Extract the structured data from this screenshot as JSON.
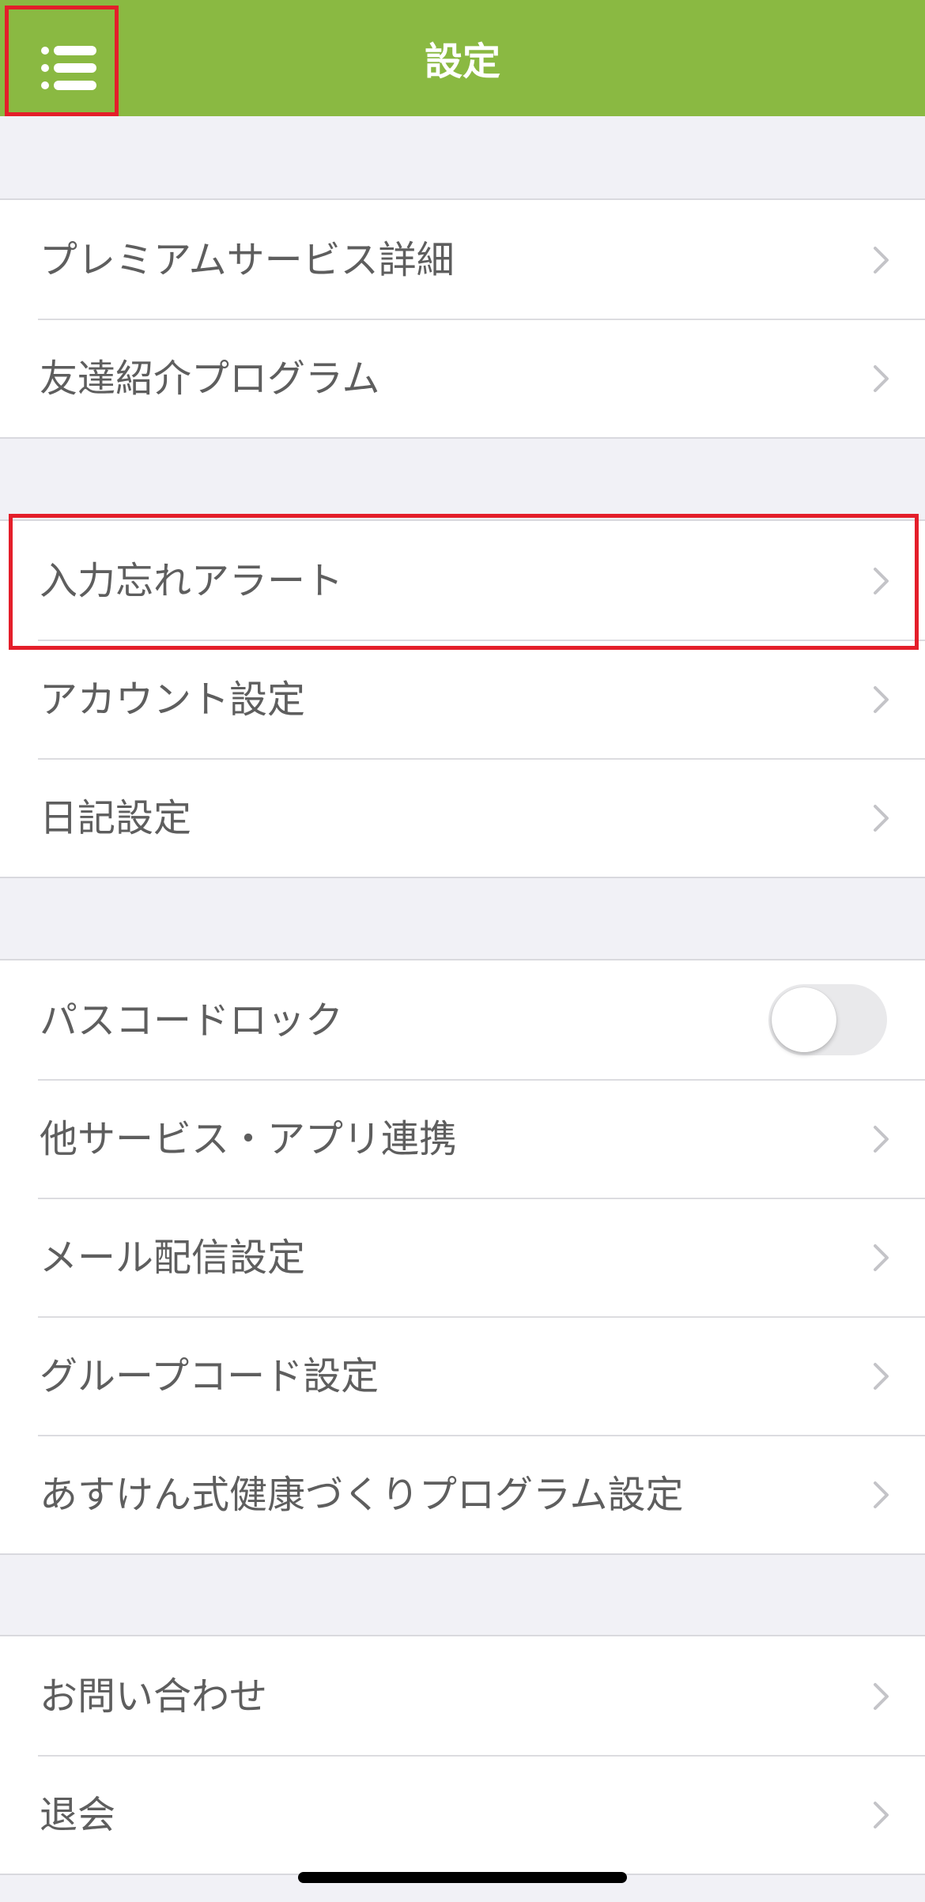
{
  "header": {
    "title": "設定",
    "menu_icon": "list-menu-icon",
    "background": "#8ab942"
  },
  "groups": [
    {
      "items": [
        {
          "label": "プレミアムサービス詳細",
          "control": "chevron"
        },
        {
          "label": "友達紹介プログラム",
          "control": "chevron"
        }
      ]
    },
    {
      "items": [
        {
          "label": "入力忘れアラート",
          "control": "chevron",
          "highlighted": true
        },
        {
          "label": "アカウント設定",
          "control": "chevron"
        },
        {
          "label": "日記設定",
          "control": "chevron"
        }
      ]
    },
    {
      "items": [
        {
          "label": "パスコードロック",
          "control": "toggle",
          "toggle_on": false
        },
        {
          "label": "他サービス・アプリ連携",
          "control": "chevron"
        },
        {
          "label": "メール配信設定",
          "control": "chevron"
        },
        {
          "label": "グループコード設定",
          "control": "chevron"
        },
        {
          "label": "あすけん式健康づくりプログラム設定",
          "control": "chevron"
        }
      ]
    },
    {
      "items": [
        {
          "label": "お問い合わせ",
          "control": "chevron"
        },
        {
          "label": "退会",
          "control": "chevron"
        }
      ]
    }
  ],
  "colors": {
    "accent": "#8ab942",
    "highlight_border": "#e41e2a",
    "background": "#f1f1f6",
    "text": "#5e5e5e",
    "chevron": "#c4c4c8"
  }
}
